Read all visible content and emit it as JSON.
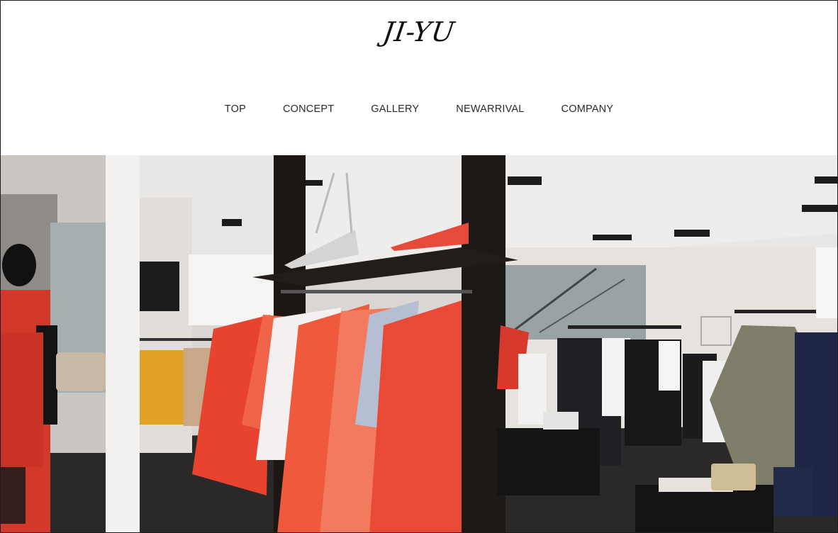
{
  "header": {
    "logo": "JI-YU"
  },
  "nav": {
    "items": [
      {
        "label": "TOP"
      },
      {
        "label": "CONCEPT"
      },
      {
        "label": "GALLERY"
      },
      {
        "label": "NEWARRIVAL"
      },
      {
        "label": "COMPANY"
      }
    ]
  },
  "colors": {
    "header_bg": "#ffffff",
    "nav_text": "#2a2a2a",
    "border": "#1a1a1a"
  }
}
